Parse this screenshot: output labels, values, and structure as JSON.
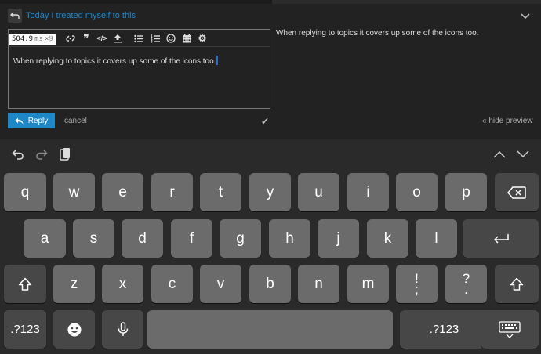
{
  "composer": {
    "reply_to_title": "Today I treated myself to this",
    "timing": {
      "value": "504.9",
      "unit": "ms",
      "count": "×9"
    },
    "editor_text": "When replying to topics it covers up some of the icons too.",
    "preview_text": "When replying to topics it covers up some of the icons too.",
    "reply_label": "Reply",
    "cancel_label": "cancel",
    "hide_preview_label": "« hide preview",
    "accent_color": "#1e88c7",
    "toolbar_icons": [
      "italic-icon",
      "link-icon",
      "quote-icon",
      "code-icon",
      "upload-icon",
      "bullet-list-icon",
      "numbered-list-icon",
      "emoji-icon",
      "calendar-icon",
      "gear-icon"
    ]
  },
  "keyboard": {
    "row1": [
      "q",
      "w",
      "e",
      "r",
      "t",
      "y",
      "u",
      "i",
      "o",
      "p"
    ],
    "row2": [
      "a",
      "s",
      "d",
      "f",
      "g",
      "h",
      "j",
      "k",
      "l"
    ],
    "row3": [
      "z",
      "x",
      "c",
      "v",
      "b",
      "n",
      "m"
    ],
    "punct1": {
      "top": "!",
      "bottom": ";"
    },
    "punct2": {
      "top": "?",
      "bottom": "."
    },
    "numbers_label": ".?123",
    "numbers_label_right": ".?123"
  }
}
